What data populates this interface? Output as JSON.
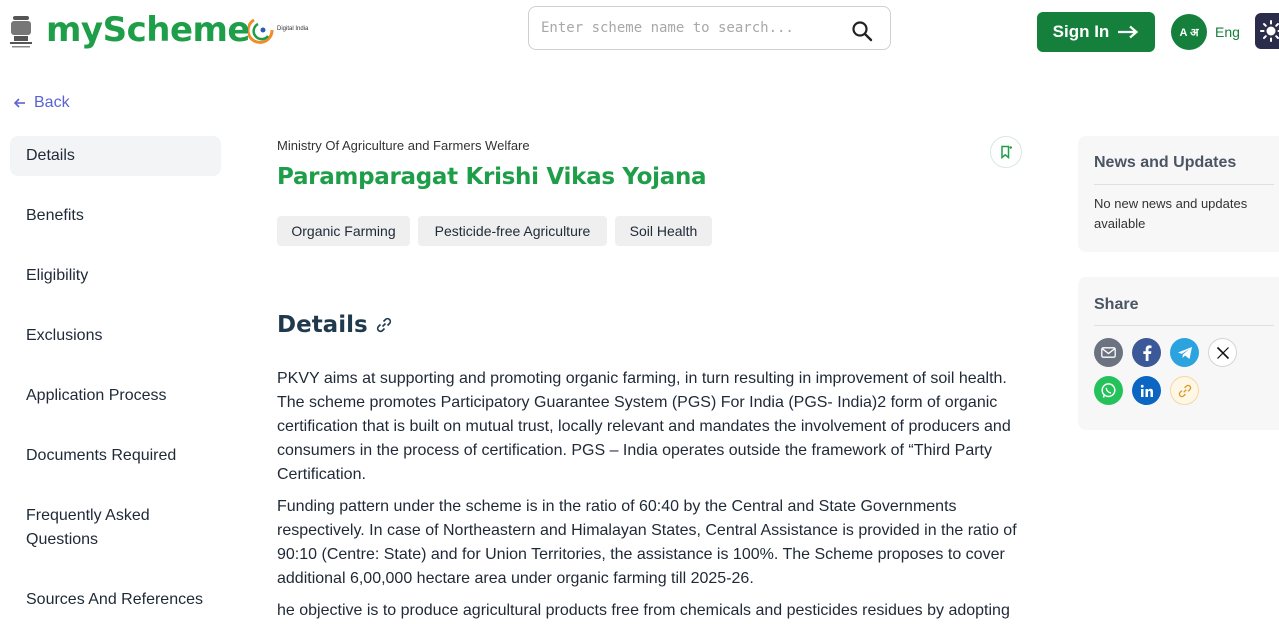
{
  "header": {
    "brand_my": "my",
    "brand_scheme": "Scheme",
    "digital_india_text": "Digital India",
    "search_placeholder": "Enter scheme name to search...",
    "signin_label": "Sign In",
    "lang_glyph": "A अ",
    "lang_label": "Eng"
  },
  "back_label": "Back",
  "sidebar": {
    "items": [
      {
        "label": "Details",
        "active": true
      },
      {
        "label": "Benefits"
      },
      {
        "label": "Eligibility"
      },
      {
        "label": "Exclusions"
      },
      {
        "label": "Application Process"
      },
      {
        "label": "Documents Required"
      },
      {
        "label": "Frequently Asked Questions"
      },
      {
        "label": "Sources And References"
      }
    ]
  },
  "main": {
    "ministry": "Ministry Of Agriculture and Farmers Welfare",
    "title": "Paramparagat Krishi Vikas Yojana",
    "tags": [
      "Organic Farming",
      "Pesticide-free Agriculture",
      "Soil Health"
    ],
    "details_heading": "Details",
    "paragraphs": [
      "PKVY aims at supporting and promoting organic farming, in turn resulting in improvement of soil health. The scheme promotes Participatory Guarantee System (PGS) For India (PGS- India)2 form of organic certification that is built on mutual trust, locally relevant and mandates the involvement of producers and consumers in the process of certification. PGS – India operates outside the framework of “Third Party Certification.",
      "Funding pattern under the scheme is in the ratio of 60:40 by the Central and State Governments respectively. In case of Northeastern and Himalayan States, Central Assistance is provided in the ratio of 90:10 (Centre: State) and for Union Territories, the assistance is 100%. The Scheme proposes to cover additional  6,00,000 hectare area under organic farming till 2025-26.",
      "he objective is to produce agricultural products free from chemicals and pesticides residues by adopting"
    ]
  },
  "news": {
    "title": "News and Updates",
    "text": "No new news and updates available"
  },
  "share": {
    "title": "Share",
    "icons": [
      "email-icon",
      "facebook-icon",
      "telegram-icon",
      "x-icon",
      "whatsapp-icon",
      "linkedin-icon",
      "copy-link-icon"
    ]
  },
  "colors": {
    "brand_green": "#1e9e48",
    "button_green": "#14803c",
    "link_purple": "#5b63d3"
  }
}
